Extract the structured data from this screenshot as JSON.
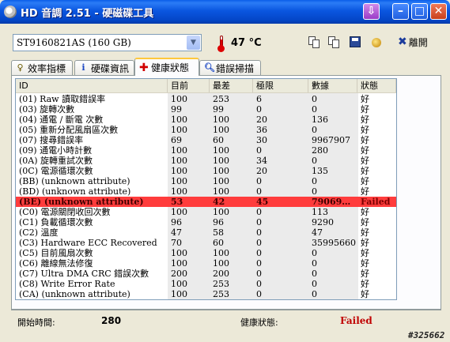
{
  "window": {
    "title": "HD 音調 2.51 - 硬磁碟工具"
  },
  "toolbar": {
    "drive": "ST9160821AS (160 GB)",
    "temperature": "47 °C",
    "exit_label": "離開"
  },
  "tabs": [
    {
      "label": "效率指標",
      "icon": "lightbulb-icon"
    },
    {
      "label": "硬碟資訊",
      "icon": "info-icon"
    },
    {
      "label": "健康狀態",
      "icon": "health-cross-icon",
      "active": true
    },
    {
      "label": "錯誤掃描",
      "icon": "magnifier-icon"
    }
  ],
  "table": {
    "columns": [
      "ID",
      "目前",
      "最差",
      "極限",
      "數據",
      "狀態"
    ],
    "rows": [
      {
        "id": "(01) Raw 讀取錯誤率",
        "current": "100",
        "worst": "253",
        "threshold": "6",
        "data": "0",
        "status": "好"
      },
      {
        "id": "(03) 旋轉次數",
        "current": "99",
        "worst": "99",
        "threshold": "0",
        "data": "0",
        "status": "好"
      },
      {
        "id": "(04) 通電 / 斷電 次數",
        "current": "100",
        "worst": "100",
        "threshold": "20",
        "data": "136",
        "status": "好"
      },
      {
        "id": "(05) 重新分配風扇區次數",
        "current": "100",
        "worst": "100",
        "threshold": "36",
        "data": "0",
        "status": "好"
      },
      {
        "id": "(07) 搜尋錯誤率",
        "current": "69",
        "worst": "60",
        "threshold": "30",
        "data": "9967907",
        "status": "好"
      },
      {
        "id": "(09) 通電小時計數",
        "current": "100",
        "worst": "100",
        "threshold": "0",
        "data": "280",
        "status": "好"
      },
      {
        "id": "(0A) 旋轉重試次數",
        "current": "100",
        "worst": "100",
        "threshold": "34",
        "data": "0",
        "status": "好"
      },
      {
        "id": "(0C) 電源循環次數",
        "current": "100",
        "worst": "100",
        "threshold": "20",
        "data": "135",
        "status": "好"
      },
      {
        "id": "(BB) (unknown attribute)",
        "current": "100",
        "worst": "100",
        "threshold": "0",
        "data": "0",
        "status": "好"
      },
      {
        "id": "(BD) (unknown attribute)",
        "current": "100",
        "worst": "100",
        "threshold": "0",
        "data": "0",
        "status": "好"
      },
      {
        "id": "(BE) (unknown attribute)",
        "current": "53",
        "worst": "42",
        "threshold": "45",
        "data": "79069…",
        "status": "Failed",
        "failed": true
      },
      {
        "id": "(C0) 電源關閉收回次數",
        "current": "100",
        "worst": "100",
        "threshold": "0",
        "data": "113",
        "status": "好"
      },
      {
        "id": "(C1) 負載循環次數",
        "current": "96",
        "worst": "96",
        "threshold": "0",
        "data": "9290",
        "status": "好"
      },
      {
        "id": "(C2) 溫度",
        "current": "47",
        "worst": "58",
        "threshold": "0",
        "data": "47",
        "status": "好"
      },
      {
        "id": "(C3) Hardware ECC Recovered",
        "current": "70",
        "worst": "60",
        "threshold": "0",
        "data": "35995660",
        "status": "好"
      },
      {
        "id": "(C5) 目前風扇次數",
        "current": "100",
        "worst": "100",
        "threshold": "0",
        "data": "0",
        "status": "好"
      },
      {
        "id": "(C6) 離線無法修復",
        "current": "100",
        "worst": "100",
        "threshold": "0",
        "data": "0",
        "status": "好"
      },
      {
        "id": "(C7) Ultra DMA CRC 錯誤次數",
        "current": "200",
        "worst": "200",
        "threshold": "0",
        "data": "0",
        "status": "好"
      },
      {
        "id": "(C8) Write Error Rate",
        "current": "100",
        "worst": "253",
        "threshold": "0",
        "data": "0",
        "status": "好"
      },
      {
        "id": "(CA) (unknown attribute)",
        "current": "100",
        "worst": "253",
        "threshold": "0",
        "data": "0",
        "status": "好"
      }
    ]
  },
  "status": {
    "start_time_label": "開始時間:",
    "start_time_value": "280",
    "health_label": "健康狀態:",
    "health_value": "Failed"
  },
  "watermark": "#325662",
  "colors": {
    "failed_row": "#ff3c3c",
    "failed_text": "#c00000",
    "titlebar": "#0a56e0"
  }
}
